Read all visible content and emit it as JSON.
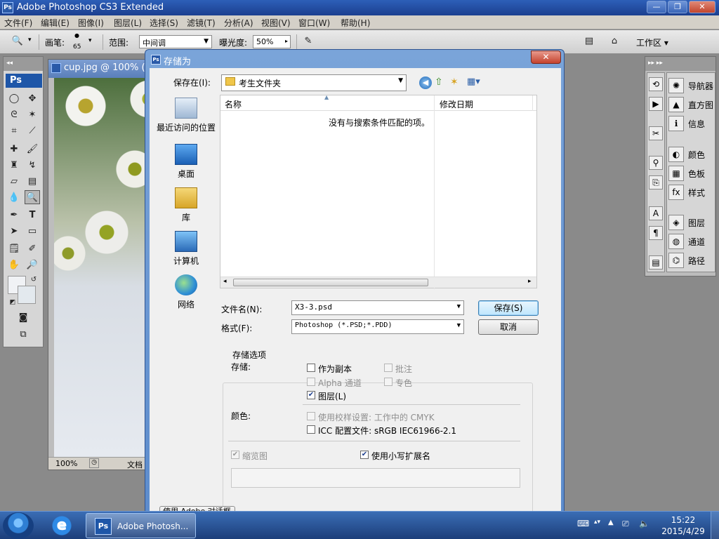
{
  "app": {
    "title": "Adobe Photoshop CS3 Extended",
    "badge": "Ps"
  },
  "menu": [
    "文件(F)",
    "编辑(E)",
    "图像(I)",
    "图层(L)",
    "选择(S)",
    "滤镜(T)",
    "分析(A)",
    "视图(V)",
    "窗口(W)",
    "帮助(H)"
  ],
  "options": {
    "brush_label": "画笔:",
    "brush_size": "65",
    "range_label": "范围:",
    "range_value": "中间调",
    "exposure_label": "曝光度:",
    "exposure_value": "50%",
    "workspace": "工作区 ▾"
  },
  "document": {
    "title": "cup.jpg @ 100% (",
    "zoom": "100%",
    "status": "文档"
  },
  "palettes": [
    "导航器",
    "直方图",
    "信息",
    "颜色",
    "色板",
    "样式",
    "图层",
    "通道",
    "路径"
  ],
  "dialog": {
    "title": "存储为",
    "save_in_label": "保存在(I):",
    "save_in_value": "考生文件夹",
    "places": [
      "最近访问的位置",
      "桌面",
      "库",
      "计算机",
      "网络"
    ],
    "columns": [
      "名称",
      "修改日期"
    ],
    "empty_message": "没有与搜索条件匹配的项。",
    "filename_label": "文件名(N):",
    "filename_value": "X3-3.psd",
    "format_label": "格式(F):",
    "format_value": "Photoshop (*.PSD;*.PDD)",
    "save_button": "保存(S)",
    "cancel_button": "取消",
    "options_title": "存储选项",
    "save_label": "存储:",
    "opt_as_copy": "作为副本",
    "opt_notes": "批注",
    "opt_alpha": "Alpha 通道",
    "opt_spot": "专色",
    "opt_layers": "图层(L)",
    "color_label": "颜色:",
    "opt_proof": "使用校样设置: 工作中的 CMYK",
    "opt_icc": "ICC 配置文件: sRGB IEC61966-2.1",
    "opt_thumbnail": "缩览图",
    "opt_lowercase": "使用小写扩展名",
    "bottom_cut_text": "使用 Adobe 对话框"
  },
  "taskbar": {
    "ps_task": "Adobe Photosh...",
    "time": "15:22",
    "date": "2015/4/29"
  },
  "colors": {
    "accent": "#2a5aa8",
    "dialog_frame": "#6f98d2"
  }
}
